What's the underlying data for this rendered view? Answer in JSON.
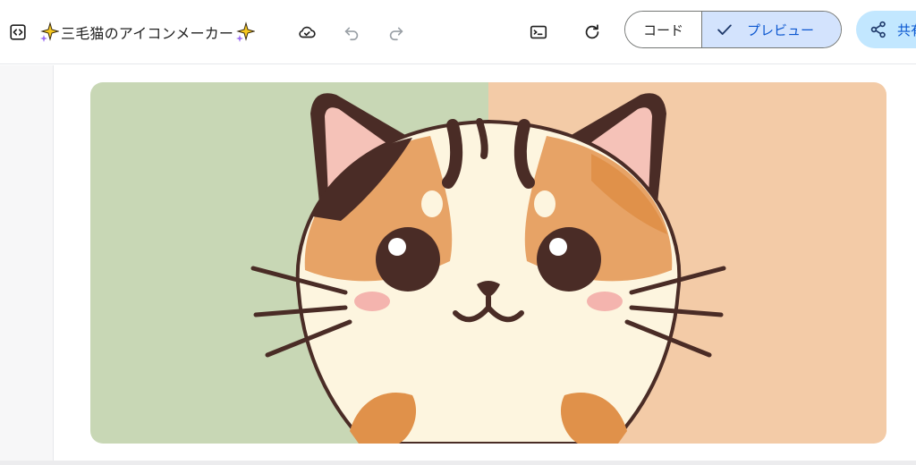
{
  "toolbar": {
    "code_toggle_icon": "code-brackets-icon",
    "title": "三毛猫のアイコンメーカー",
    "title_decoration_icon": "sparkle-icon",
    "save_cloud_icon": "cloud-check-icon",
    "undo_icon": "undo-icon",
    "redo_icon": "redo-icon",
    "console_icon": "terminal-icon",
    "refresh_icon": "refresh-icon",
    "view_toggle": {
      "code_label": "コード",
      "preview_label": "プレビュー",
      "selected": "プレビュー"
    },
    "share_label": "共有",
    "share_icon": "share-icon"
  },
  "preview": {
    "image_subject": "calico-cat-icon",
    "colors": {
      "bg_left": "#c8d7b5",
      "bg_right": "#f3cba7",
      "fur_orange": "#e0914a",
      "fur_cream": "#fdf5df",
      "fur_dark": "#4a2c26",
      "ear_inner": "#f5c2b8",
      "cheek": "#f4b4ae"
    }
  },
  "theme": {
    "accent": "#0b57d0",
    "toggle_selected_bg": "#d3e3fd",
    "share_bg": "#c2e7ff"
  }
}
